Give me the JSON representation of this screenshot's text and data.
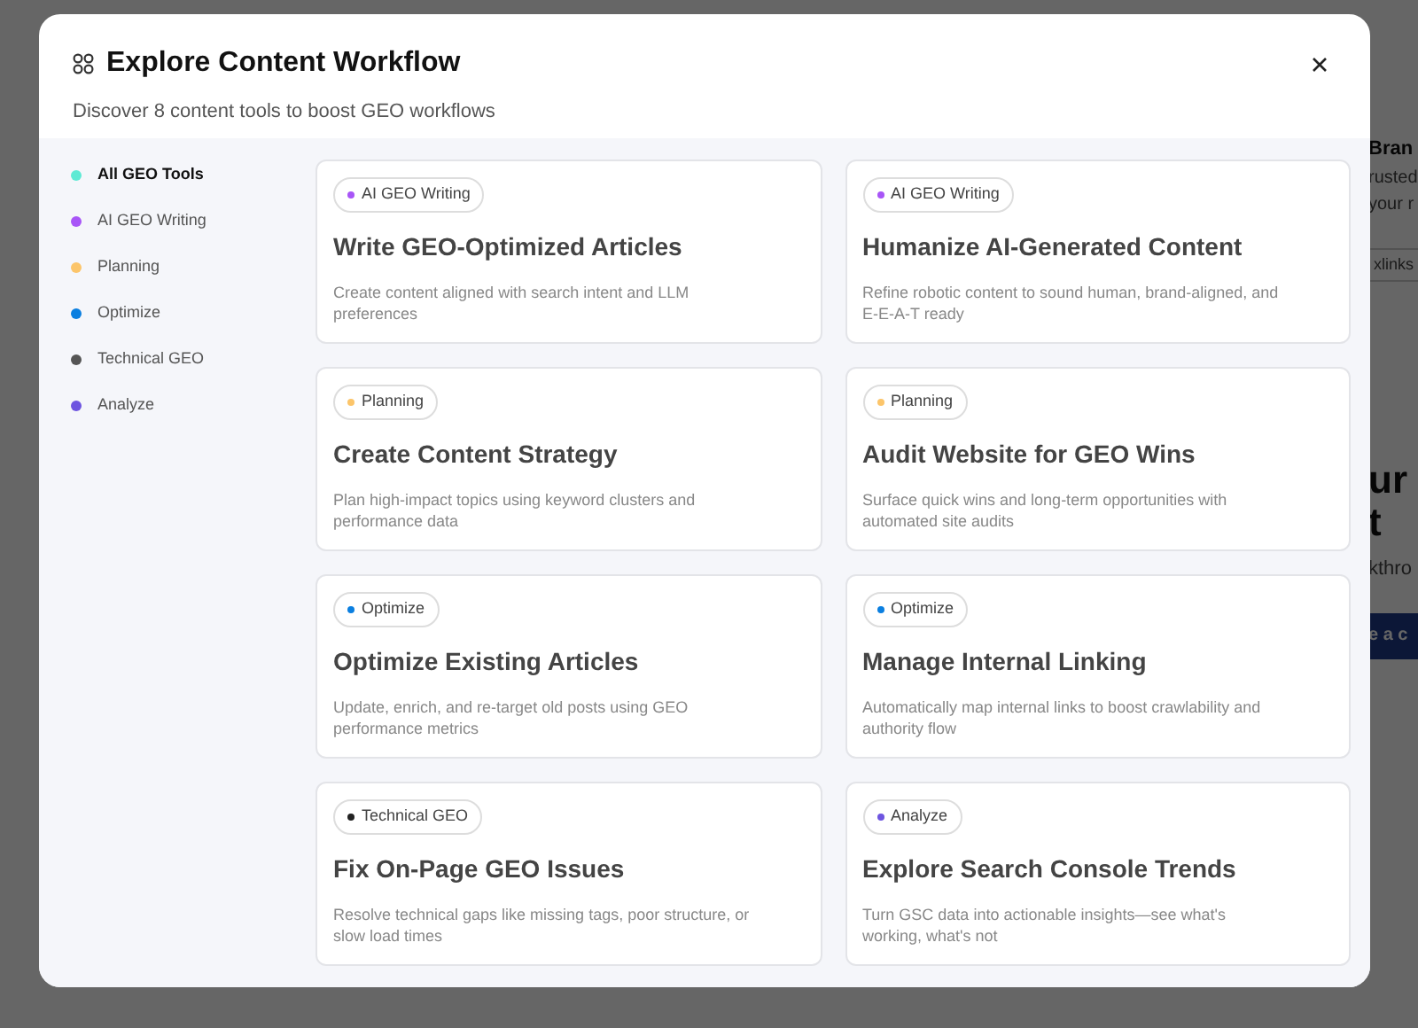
{
  "background": {
    "side_texts": [
      "Bran",
      "rusted",
      "your r"
    ],
    "chip": "xlinks",
    "big_texts": [
      "ur",
      "t"
    ],
    "subtext": "kthro",
    "button": "e a c"
  },
  "modal": {
    "title": "Explore Content Workflow",
    "subtitle": "Discover 8 content tools to boost GEO workflows"
  },
  "sidebar": {
    "items": [
      {
        "label": "All GEO Tools",
        "color": "#5eead4",
        "selected": true
      },
      {
        "label": "AI GEO Writing",
        "color": "#a855f7",
        "selected": false
      },
      {
        "label": "Planning",
        "color": "#fcc56a",
        "selected": false
      },
      {
        "label": "Optimize",
        "color": "#0b7fe0",
        "selected": false
      },
      {
        "label": "Technical GEO",
        "color": "#555555",
        "selected": false
      },
      {
        "label": "Analyze",
        "color": "#6e55e0",
        "selected": false
      }
    ]
  },
  "cards": [
    {
      "tag": "AI GEO Writing",
      "color": "#a855f7",
      "title": "Write GEO-Optimized Articles",
      "description": "Create content aligned with search intent and LLM preferences"
    },
    {
      "tag": "AI GEO Writing",
      "color": "#a855f7",
      "title": "Humanize AI-Generated Content",
      "description": "Refine robotic content to sound human, brand-aligned, and E-E-A-T ready"
    },
    {
      "tag": "Planning",
      "color": "#fcc56a",
      "title": "Create Content Strategy",
      "description": "Plan high-impact topics using keyword clusters and performance data"
    },
    {
      "tag": "Planning",
      "color": "#fcc56a",
      "title": "Audit Website for GEO Wins",
      "description": "Surface quick wins and long-term opportunities with automated site audits"
    },
    {
      "tag": "Optimize",
      "color": "#0b7fe0",
      "title": "Optimize Existing Articles",
      "description": "Update, enrich, and re-target old posts using GEO performance metrics"
    },
    {
      "tag": "Optimize",
      "color": "#0b7fe0",
      "title": "Manage Internal Linking",
      "description": "Automatically map internal links to boost crawlability and authority flow"
    },
    {
      "tag": "Technical GEO",
      "color": "#222222",
      "title": "Fix On-Page GEO Issues",
      "description": "Resolve technical gaps like missing tags, poor structure, or slow load times"
    },
    {
      "tag": "Analyze",
      "color": "#6e55e0",
      "title": "Explore Search Console Trends",
      "description": "Turn GSC data into actionable insights—see what's working, what's not"
    }
  ]
}
